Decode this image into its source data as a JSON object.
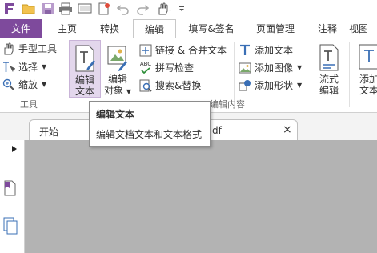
{
  "tabs": {
    "file": "文件",
    "home": "主页",
    "convert": "转换",
    "edit": "编辑",
    "fill_sign": "填写&签名",
    "page_manage": "页面管理",
    "comment": "注释",
    "view": "视图"
  },
  "ribbon": {
    "tools": {
      "hand": "手型工具",
      "select": "选择",
      "zoom": "缩放",
      "label": "工具"
    },
    "edit_text": {
      "line1": "编辑",
      "line2": "文本"
    },
    "edit_object": {
      "line1": "编辑",
      "line2": "对象"
    },
    "link_merge": "链接 & 合并文本",
    "spellcheck": "拼写检查",
    "search_replace": "搜索&替换",
    "spell_icon_text": "ABC",
    "add_text": "添加文本",
    "add_image": "添加图像",
    "add_shape": "添加形状",
    "flow_edit": {
      "line1": "流式",
      "line2": "编辑"
    },
    "add_text_box": {
      "line1": "添加",
      "line2": "文本"
    },
    "group_edit_content": "编辑内容"
  },
  "document": {
    "tab_label": "开始",
    "tab_filename_tail": "df",
    "close_symbol": "×"
  },
  "tooltip": {
    "title": "编辑文本",
    "description": "编辑文档文本和文本格式"
  },
  "colors": {
    "accent": "#7e4a9c",
    "active_button": "#e3d7ec",
    "doc_background": "#b3b3b3"
  }
}
